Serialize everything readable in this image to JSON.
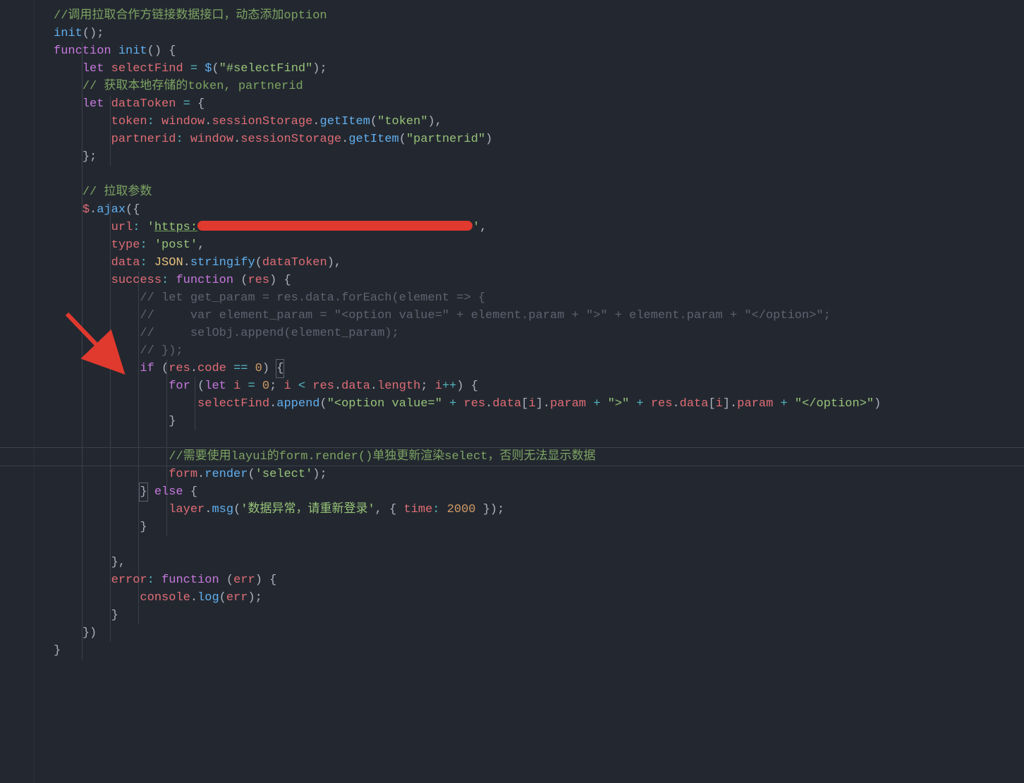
{
  "editor": {
    "language": "javascript",
    "theme": "dark",
    "current_line_index": 25
  },
  "annotation": {
    "arrow_color": "#e0392e",
    "url_redacted": true
  },
  "lines": [
    {
      "indent": 0,
      "tokens": [
        [
          "comment-green",
          "//调用拉取合作方链接数据接口，动态添加option"
        ]
      ]
    },
    {
      "indent": 0,
      "tokens": [
        [
          "func",
          "init"
        ],
        [
          "paren",
          "();"
        ]
      ]
    },
    {
      "indent": 0,
      "tokens": [
        [
          "key",
          "function"
        ],
        [
          "plain",
          " "
        ],
        [
          "func",
          "init"
        ],
        [
          "paren",
          "() {"
        ]
      ]
    },
    {
      "indent": 1,
      "tokens": [
        [
          "key",
          "let"
        ],
        [
          "plain",
          " "
        ],
        [
          "var",
          "selectFind"
        ],
        [
          "plain",
          " "
        ],
        [
          "op",
          "="
        ],
        [
          "plain",
          " "
        ],
        [
          "func",
          "$"
        ],
        [
          "paren",
          "("
        ],
        [
          "str",
          "\"#selectFind\""
        ],
        [
          "paren",
          ");"
        ]
      ]
    },
    {
      "indent": 1,
      "tokens": [
        [
          "comment-green",
          "// 获取本地存储的token, partnerid"
        ]
      ]
    },
    {
      "indent": 1,
      "tokens": [
        [
          "key",
          "let"
        ],
        [
          "plain",
          " "
        ],
        [
          "var",
          "dataToken"
        ],
        [
          "plain",
          " "
        ],
        [
          "op",
          "="
        ],
        [
          "plain",
          " {"
        ]
      ]
    },
    {
      "indent": 2,
      "tokens": [
        [
          "prop",
          "token"
        ],
        [
          "op",
          ":"
        ],
        [
          "plain",
          " "
        ],
        [
          "var",
          "window"
        ],
        [
          "plain",
          "."
        ],
        [
          "var",
          "sessionStorage"
        ],
        [
          "plain",
          "."
        ],
        [
          "func",
          "getItem"
        ],
        [
          "paren",
          "("
        ],
        [
          "str",
          "\"token\""
        ],
        [
          "paren",
          "),"
        ]
      ]
    },
    {
      "indent": 2,
      "tokens": [
        [
          "prop",
          "partnerid"
        ],
        [
          "op",
          ":"
        ],
        [
          "plain",
          " "
        ],
        [
          "var",
          "window"
        ],
        [
          "plain",
          "."
        ],
        [
          "var",
          "sessionStorage"
        ],
        [
          "plain",
          "."
        ],
        [
          "func",
          "getItem"
        ],
        [
          "paren",
          "("
        ],
        [
          "str",
          "\"partnerid\""
        ],
        [
          "paren",
          ")"
        ]
      ]
    },
    {
      "indent": 1,
      "tokens": [
        [
          "paren",
          "};"
        ]
      ]
    },
    {
      "indent": 0,
      "tokens": [
        [
          "plain",
          ""
        ]
      ]
    },
    {
      "indent": 1,
      "tokens": [
        [
          "comment-green",
          "// 拉取参数"
        ]
      ]
    },
    {
      "indent": 1,
      "tokens": [
        [
          "var",
          "$"
        ],
        [
          "plain",
          "."
        ],
        [
          "func",
          "ajax"
        ],
        [
          "paren",
          "({"
        ]
      ]
    },
    {
      "indent": 2,
      "tokens": [
        [
          "prop",
          "url"
        ],
        [
          "op",
          ":"
        ],
        [
          "plain",
          " "
        ],
        [
          "str",
          "'"
        ],
        [
          "str-url",
          "https:"
        ],
        [
          "redact",
          ""
        ],
        [
          "str",
          "'"
        ],
        [
          "plain",
          ","
        ]
      ]
    },
    {
      "indent": 2,
      "tokens": [
        [
          "prop",
          "type"
        ],
        [
          "op",
          ":"
        ],
        [
          "plain",
          " "
        ],
        [
          "str",
          "'post'"
        ],
        [
          "plain",
          ","
        ]
      ]
    },
    {
      "indent": 2,
      "tokens": [
        [
          "prop",
          "data"
        ],
        [
          "op",
          ":"
        ],
        [
          "plain",
          " "
        ],
        [
          "name",
          "JSON"
        ],
        [
          "plain",
          "."
        ],
        [
          "func",
          "stringify"
        ],
        [
          "paren",
          "("
        ],
        [
          "var",
          "dataToken"
        ],
        [
          "paren",
          "),"
        ]
      ]
    },
    {
      "indent": 2,
      "tokens": [
        [
          "prop",
          "success"
        ],
        [
          "op",
          ":"
        ],
        [
          "plain",
          " "
        ],
        [
          "key",
          "function"
        ],
        [
          "plain",
          " "
        ],
        [
          "paren",
          "("
        ],
        [
          "var",
          "res"
        ],
        [
          "paren",
          ") {"
        ]
      ]
    },
    {
      "indent": 3,
      "tokens": [
        [
          "comment",
          "// let get_param = res.data.forEach(element => {"
        ]
      ]
    },
    {
      "indent": 3,
      "tokens": [
        [
          "comment",
          "//     var element_param = \"<option value=\" + element.param + \">\" + element.param + \"</option>\";"
        ]
      ]
    },
    {
      "indent": 3,
      "tokens": [
        [
          "comment",
          "//     selObj.append(element_param);"
        ]
      ]
    },
    {
      "indent": 3,
      "tokens": [
        [
          "comment",
          "// });"
        ]
      ]
    },
    {
      "indent": 3,
      "tokens": [
        [
          "key",
          "if"
        ],
        [
          "plain",
          " "
        ],
        [
          "paren",
          "("
        ],
        [
          "var",
          "res"
        ],
        [
          "plain",
          "."
        ],
        [
          "prop",
          "code"
        ],
        [
          "plain",
          " "
        ],
        [
          "op",
          "=="
        ],
        [
          "plain",
          " "
        ],
        [
          "num",
          "0"
        ],
        [
          "paren",
          ") "
        ],
        [
          "brace-match",
          "{"
        ]
      ]
    },
    {
      "indent": 4,
      "tokens": [
        [
          "key",
          "for"
        ],
        [
          "plain",
          " "
        ],
        [
          "paren",
          "("
        ],
        [
          "key",
          "let"
        ],
        [
          "plain",
          " "
        ],
        [
          "var",
          "i"
        ],
        [
          "plain",
          " "
        ],
        [
          "op",
          "="
        ],
        [
          "plain",
          " "
        ],
        [
          "num",
          "0"
        ],
        [
          "plain",
          "; "
        ],
        [
          "var",
          "i"
        ],
        [
          "plain",
          " "
        ],
        [
          "op",
          "<"
        ],
        [
          "plain",
          " "
        ],
        [
          "var",
          "res"
        ],
        [
          "plain",
          "."
        ],
        [
          "prop",
          "data"
        ],
        [
          "plain",
          "."
        ],
        [
          "prop",
          "length"
        ],
        [
          "plain",
          "; "
        ],
        [
          "var",
          "i"
        ],
        [
          "op",
          "++"
        ],
        [
          "paren",
          ") {"
        ]
      ]
    },
    {
      "indent": 5,
      "tokens": [
        [
          "var",
          "selectFind"
        ],
        [
          "plain",
          "."
        ],
        [
          "func",
          "append"
        ],
        [
          "paren",
          "("
        ],
        [
          "str",
          "\"<option value=\""
        ],
        [
          "plain",
          " "
        ],
        [
          "op",
          "+"
        ],
        [
          "plain",
          " "
        ],
        [
          "var",
          "res"
        ],
        [
          "plain",
          "."
        ],
        [
          "prop",
          "data"
        ],
        [
          "paren",
          "["
        ],
        [
          "var",
          "i"
        ],
        [
          "paren",
          "]."
        ],
        [
          "prop",
          "param"
        ],
        [
          "plain",
          " "
        ],
        [
          "op",
          "+"
        ],
        [
          "plain",
          " "
        ],
        [
          "str",
          "\">\""
        ],
        [
          "plain",
          " "
        ],
        [
          "op",
          "+"
        ],
        [
          "plain",
          " "
        ],
        [
          "var",
          "res"
        ],
        [
          "plain",
          "."
        ],
        [
          "prop",
          "data"
        ],
        [
          "paren",
          "["
        ],
        [
          "var",
          "i"
        ],
        [
          "paren",
          "]."
        ],
        [
          "prop",
          "param"
        ],
        [
          "plain",
          " "
        ],
        [
          "op",
          "+"
        ],
        [
          "plain",
          " "
        ],
        [
          "str",
          "\"</option>\""
        ],
        [
          "paren",
          ")"
        ]
      ]
    },
    {
      "indent": 4,
      "tokens": [
        [
          "paren",
          "}"
        ]
      ]
    },
    {
      "indent": 0,
      "tokens": [
        [
          "plain",
          ""
        ]
      ]
    },
    {
      "indent": 4,
      "tokens": [
        [
          "comment-green",
          "//需要使用layui的form.render()单独更新渲染select，否则无法显示数据"
        ]
      ]
    },
    {
      "indent": 4,
      "tokens": [
        [
          "var",
          "form"
        ],
        [
          "plain",
          "."
        ],
        [
          "func",
          "render"
        ],
        [
          "paren",
          "("
        ],
        [
          "str",
          "'select'"
        ],
        [
          "paren",
          ");"
        ]
      ]
    },
    {
      "indent": 3,
      "tokens": [
        [
          "brace-match",
          "}"
        ],
        [
          "plain",
          " "
        ],
        [
          "key",
          "else"
        ],
        [
          "plain",
          " {"
        ]
      ]
    },
    {
      "indent": 4,
      "tokens": [
        [
          "var",
          "layer"
        ],
        [
          "plain",
          "."
        ],
        [
          "func",
          "msg"
        ],
        [
          "paren",
          "("
        ],
        [
          "str",
          "'数据异常，请重新登录'"
        ],
        [
          "plain",
          ", { "
        ],
        [
          "prop",
          "time"
        ],
        [
          "op",
          ":"
        ],
        [
          "plain",
          " "
        ],
        [
          "num",
          "2000"
        ],
        [
          "plain",
          " });"
        ]
      ]
    },
    {
      "indent": 3,
      "tokens": [
        [
          "paren",
          "}"
        ]
      ]
    },
    {
      "indent": 0,
      "tokens": [
        [
          "plain",
          ""
        ]
      ]
    },
    {
      "indent": 2,
      "tokens": [
        [
          "paren",
          "},"
        ]
      ]
    },
    {
      "indent": 2,
      "tokens": [
        [
          "prop",
          "error"
        ],
        [
          "op",
          ":"
        ],
        [
          "plain",
          " "
        ],
        [
          "key",
          "function"
        ],
        [
          "plain",
          " "
        ],
        [
          "paren",
          "("
        ],
        [
          "var",
          "err"
        ],
        [
          "paren",
          ") {"
        ]
      ]
    },
    {
      "indent": 3,
      "tokens": [
        [
          "var",
          "console"
        ],
        [
          "plain",
          "."
        ],
        [
          "func",
          "log"
        ],
        [
          "paren",
          "("
        ],
        [
          "var",
          "err"
        ],
        [
          "paren",
          ");"
        ]
      ]
    },
    {
      "indent": 2,
      "tokens": [
        [
          "paren",
          "}"
        ]
      ]
    },
    {
      "indent": 1,
      "tokens": [
        [
          "paren",
          "})"
        ]
      ]
    },
    {
      "indent": 0,
      "tokens": [
        [
          "paren",
          "}"
        ]
      ]
    }
  ],
  "guide_segments": [
    {
      "from": 2,
      "to": 36,
      "depth": 1
    },
    {
      "from": 5,
      "to": 8,
      "depth": 2
    },
    {
      "from": 11,
      "to": 35,
      "depth": 2
    },
    {
      "from": 15,
      "to": 31,
      "depth": 3
    },
    {
      "from": 20,
      "to": 29,
      "depth": 4
    },
    {
      "from": 21,
      "to": 23,
      "depth": 5
    },
    {
      "from": 32,
      "to": 34,
      "depth": 3
    }
  ]
}
